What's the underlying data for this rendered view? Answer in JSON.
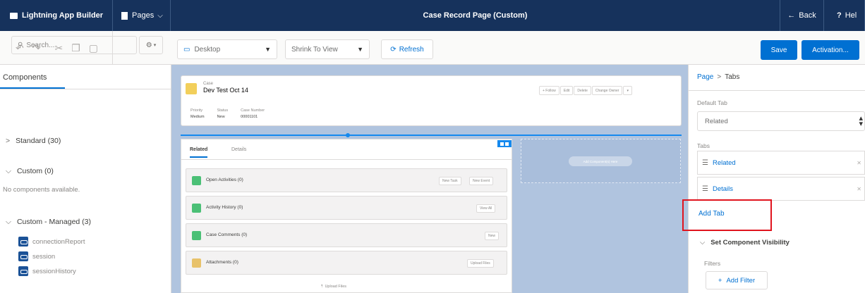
{
  "topbar": {
    "app_title": "Lightning App Builder",
    "pages_label": "Pages",
    "page_title": "Case Record Page (Custom)",
    "back_label": "Back",
    "help_label": "Hel"
  },
  "toolbar": {
    "device": "Desktop",
    "view": "Shrink To View",
    "refresh_label": "Refresh",
    "save_label": "Save",
    "activation_label": "Activation..."
  },
  "left_panel": {
    "tab_label": "Components",
    "search_placeholder": "Search...",
    "standard_label": "Standard (30)",
    "custom_label": "Custom (0)",
    "no_components": "No components available.",
    "managed_label": "Custom - Managed (3)",
    "managed_items": [
      "connectionReport",
      "session",
      "sessionHistory"
    ]
  },
  "canvas": {
    "record_type": "Case",
    "record_title": "Dev Test Oct 14",
    "header_buttons": [
      "+ Follow",
      "Edit",
      "Delete",
      "Change Owner",
      "▾"
    ],
    "fields": [
      {
        "label": "Priority",
        "value": "Medium"
      },
      {
        "label": "Status",
        "value": "New"
      },
      {
        "label": "Case Number",
        "value": "00001101"
      }
    ],
    "tabs": [
      "Related",
      "Details"
    ],
    "related_lists": [
      {
        "title": "Open Activities (0)",
        "buttons": [
          "New Task",
          "New Event"
        ],
        "color": "#4bc076"
      },
      {
        "title": "Activity History (0)",
        "buttons": [
          "View All"
        ],
        "color": "#4bc076"
      },
      {
        "title": "Case Comments (0)",
        "buttons": [
          "New"
        ],
        "color": "#4bc076"
      },
      {
        "title": "Attachments (0)",
        "buttons": [
          "Upload Files"
        ],
        "color": "#e8c26a"
      }
    ],
    "upload_label": "Upload Files",
    "add_component_label": "Add Component(s) Here"
  },
  "right_panel": {
    "crumb_page": "Page",
    "crumb_current": "Tabs",
    "default_tab_label": "Default Tab",
    "default_tab_value": "Related",
    "tabs_label": "Tabs",
    "tab_items": [
      "Related",
      "Details"
    ],
    "add_tab_label": "Add Tab",
    "visibility_label": "Set Component Visibility",
    "filters_label": "Filters",
    "add_filter_label": "Add Filter"
  },
  "colors": {
    "topbar": "#16325c",
    "brand": "#0070d2",
    "highlight": "#e0141e"
  }
}
